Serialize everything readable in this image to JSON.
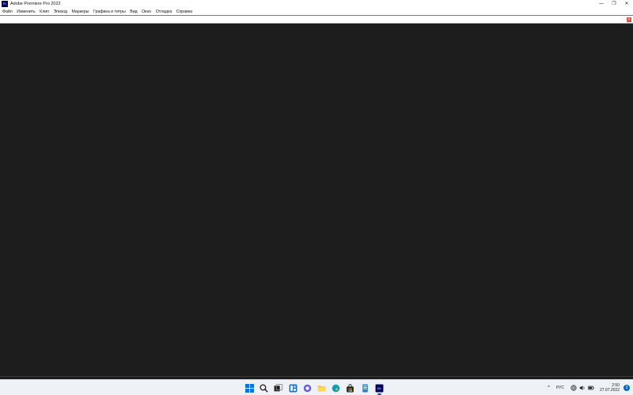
{
  "window": {
    "title": "Adobe Premiere Pro 2022",
    "app_icon_text": "Pr",
    "controls": {
      "minimize": "—",
      "restore": "❐",
      "close": "✕"
    }
  },
  "menu": {
    "items": [
      {
        "label": "Файл"
      },
      {
        "label": "Изменить"
      },
      {
        "label": "Клип"
      },
      {
        "label": "Эпизод"
      },
      {
        "label": "Маркеры"
      },
      {
        "label": "Графика и титры"
      },
      {
        "label": "Вид"
      },
      {
        "label": "Окно"
      },
      {
        "label": "Отладка"
      },
      {
        "label": "Справка"
      }
    ]
  },
  "toolstrip": {
    "close_glyph": "×"
  },
  "taskbar": {
    "icons": [
      {
        "name": "start-icon"
      },
      {
        "name": "search-icon"
      },
      {
        "name": "task-view-icon"
      },
      {
        "name": "widgets-icon"
      },
      {
        "name": "chat-icon"
      },
      {
        "name": "file-explorer-icon"
      },
      {
        "name": "edge-icon"
      },
      {
        "name": "store-icon"
      },
      {
        "name": "notepad-icon"
      },
      {
        "name": "premiere-icon",
        "active": true
      }
    ],
    "premiere_text": "Pr",
    "tray": {
      "chevron": "^",
      "language": "РУС",
      "time": "2:50",
      "date": "27.07.2022",
      "notifications": "3"
    }
  },
  "colors": {
    "workspace": "#1d1d1d",
    "premiere_brand": "#00005b",
    "accent": "#0067c0"
  }
}
